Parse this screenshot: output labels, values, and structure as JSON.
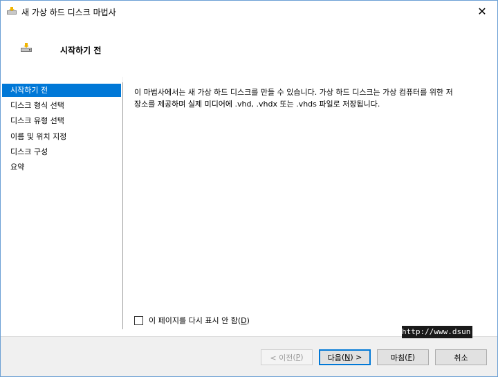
{
  "window": {
    "title": "새 가상 하드 디스크 마법사",
    "close_glyph": "✕"
  },
  "header": {
    "title": "시작하기 전"
  },
  "sidebar": {
    "items": [
      {
        "label": "시작하기 전",
        "active": true
      },
      {
        "label": "디스크 형식 선택",
        "active": false
      },
      {
        "label": "디스크 유형 선택",
        "active": false
      },
      {
        "label": "이름 및 위치 지정",
        "active": false
      },
      {
        "label": "디스크 구성",
        "active": false
      },
      {
        "label": "요약",
        "active": false
      }
    ]
  },
  "content": {
    "description": "이 마법사에서는 새 가상 하드 디스크를 만들 수 있습니다. 가상 하드 디스크는 가상 컴퓨터를 위한 저\n장소를 제공하며 실제 미디어에 .vhd, .vhdx 또는 .vhds 파일로 저장됩니다.",
    "dont_show_label": "이 페이지를 다시 표시 안 함",
    "dont_show_key": "D",
    "dont_show_checked": false
  },
  "footer": {
    "prev_label": "< 이전",
    "prev_key": "P",
    "next_label": "다음",
    "next_key": "N",
    "next_suffix": " >",
    "finish_label": "마침",
    "finish_key": "F",
    "cancel_label": "취소"
  },
  "watermark": "http://www.dsun.",
  "colors": {
    "accent": "#0078d7",
    "window_bg": "#f0f0f0"
  }
}
